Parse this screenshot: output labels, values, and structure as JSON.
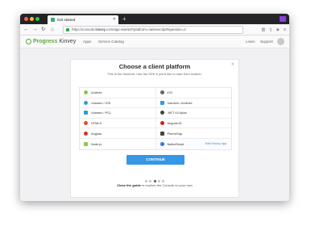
{
  "browser": {
    "tab_title": "Get started",
    "url_prefix": "https://console.",
    "url_domain": "kinvey",
    "url_rest": ".com/app-started?platform=nativescript#question=2"
  },
  "app": {
    "logo_brand": "Progress",
    "logo_product": "Kinvey",
    "nav": {
      "apps": "Apps",
      "service_catalog": "Service Catalog",
      "learn": "Learn",
      "support": "Support"
    }
  },
  "dialog": {
    "title": "Choose a client platform",
    "subtitle": "This is the frontend. Use the SDK if you'd like to start from scratch.",
    "platforms": [
      [
        {
          "label": "Android",
          "color": "#8bc34a",
          "icon": "android-icon"
        },
        {
          "label": "iOS",
          "color": "#666666",
          "icon": "apple-icon"
        }
      ],
      [
        {
          "label": "Xamarin / iOS",
          "color": "#3498db",
          "icon": "xamarin-icon"
        },
        {
          "label": "Xamarin / Android",
          "color": "#3498db",
          "icon": "xamarin-icon"
        }
      ],
      [
        {
          "label": "Xamarin / PCL",
          "color": "#3498db",
          "icon": "xamarin-icon"
        },
        {
          "label": ".NET v3.6plus",
          "color": "#444444",
          "icon": "dotnet-icon"
        }
      ],
      [
        {
          "label": "HTML5",
          "color": "#e44d26",
          "icon": "html5-icon"
        },
        {
          "label": "AngularJS",
          "color": "#dd1b16",
          "icon": "angularjs-icon"
        }
      ],
      [
        {
          "label": "Angular",
          "color": "#d32f2f",
          "icon": "angular-icon"
        },
        {
          "label": "PhoneGap",
          "color": "#444444",
          "icon": "phonegap-icon"
        }
      ],
      [
        {
          "label": "Node.js",
          "color": "#8cc84b",
          "icon": "nodejs-icon"
        },
        {
          "label": "NativeScript",
          "color": "#3f6fe0",
          "icon": "nativescript-icon",
          "link": "Edit Kinvey app"
        }
      ]
    ],
    "continue_label": "CONTINUE",
    "pagination": {
      "total": 5,
      "active": 3
    },
    "footer_bold": "Close the guide",
    "footer_rest": " to explore the Console on your own"
  }
}
